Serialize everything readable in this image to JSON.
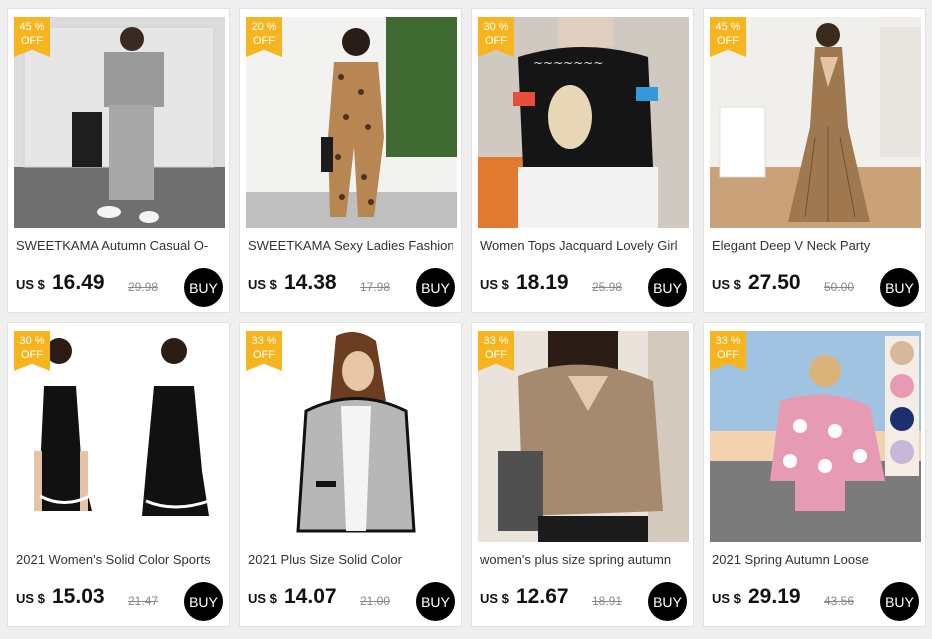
{
  "products": [
    {
      "discount": "45 %",
      "off": "OFF",
      "title": "SWEETKAMA Autumn Casual O-",
      "currency": "US $",
      "price": "16.49",
      "old_price": "29.98",
      "buy": "BUY"
    },
    {
      "discount": "20 %",
      "off": "OFF",
      "title": "SWEETKAMA Sexy Ladies Fashion",
      "currency": "US $",
      "price": "14.38",
      "old_price": "17.98",
      "buy": "BUY"
    },
    {
      "discount": "30 %",
      "off": "OFF",
      "title": "Women Tops Jacquard Lovely Girl",
      "currency": "US $",
      "price": "18.19",
      "old_price": "25.98",
      "buy": "BUY"
    },
    {
      "discount": "45 %",
      "off": "OFF",
      "title": "Elegant Deep V Neck Party",
      "currency": "US $",
      "price": "27.50",
      "old_price": "50.00",
      "buy": "BUY"
    },
    {
      "discount": "30 %",
      "off": "OFF",
      "title": "2021 Women's Solid Color Sports",
      "currency": "US $",
      "price": "15.03",
      "old_price": "21.47",
      "buy": "BUY"
    },
    {
      "discount": "33 %",
      "off": "OFF",
      "title": "2021 Plus Size Solid Color",
      "currency": "US $",
      "price": "14.07",
      "old_price": "21.00",
      "buy": "BUY"
    },
    {
      "discount": "33 %",
      "off": "OFF",
      "title": "women's plus size spring autumn",
      "currency": "US $",
      "price": "12.67",
      "old_price": "18.91",
      "buy": "BUY"
    },
    {
      "discount": "33 %",
      "off": "OFF",
      "title": "2021 Spring  Autumn Loose",
      "currency": "US $",
      "price": "29.19",
      "old_price": "43.56",
      "buy": "BUY"
    }
  ],
  "colors": {
    "badge": "#f6b51e",
    "buy_button": "#000000",
    "background": "#efefef"
  }
}
